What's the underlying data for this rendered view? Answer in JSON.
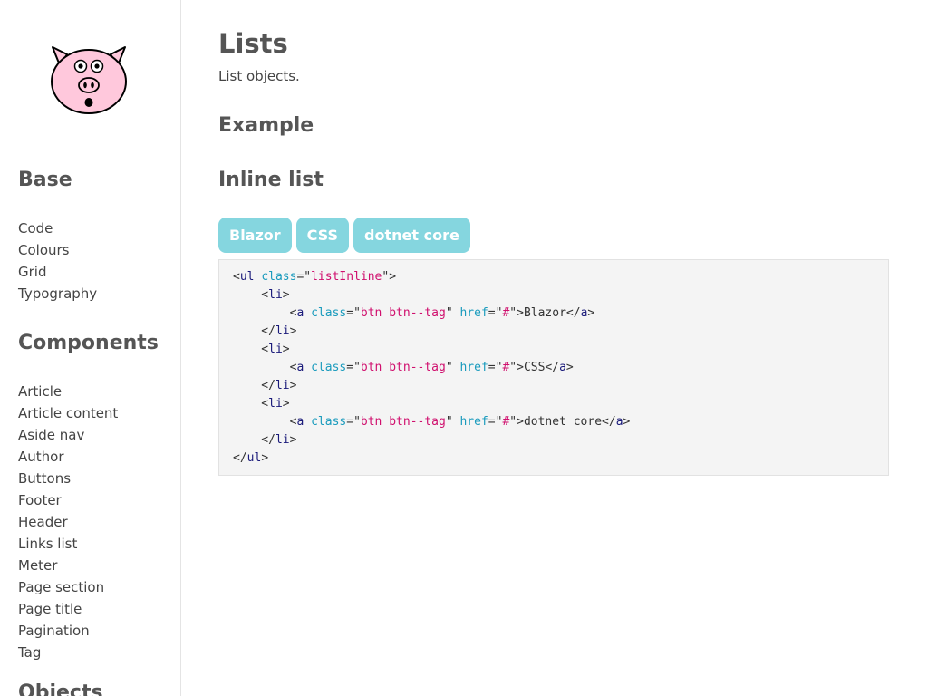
{
  "sidebar": {
    "logo": "pig-logo",
    "base_heading": "Base",
    "base_items": [
      "Code",
      "Colours",
      "Grid",
      "Typography"
    ],
    "components_heading": "Components",
    "components_items": [
      "Article",
      "Article content",
      "Aside nav",
      "Author",
      "Buttons",
      "Footer",
      "Header",
      "Links list",
      "Meter",
      "Page section",
      "Page title",
      "Pagination",
      "Tag"
    ],
    "objects_heading": "Objects"
  },
  "main": {
    "title": "Lists",
    "description": "List objects.",
    "example_heading": "Example",
    "inline_heading": "Inline list",
    "tags": [
      "Blazor",
      "CSS",
      "dotnet core"
    ]
  },
  "code": {
    "lines": [
      [
        [
          "p",
          "<"
        ],
        [
          "tg",
          "ul"
        ],
        [
          "p",
          " "
        ],
        [
          "at",
          "class"
        ],
        [
          "p",
          "=\""
        ],
        [
          "st",
          "listInline"
        ],
        [
          "p",
          "\">"
        ]
      ],
      [
        [
          "p",
          "    <"
        ],
        [
          "tg",
          "li"
        ],
        [
          "p",
          ">"
        ]
      ],
      [
        [
          "p",
          "        <"
        ],
        [
          "tg",
          "a"
        ],
        [
          "p",
          " "
        ],
        [
          "at",
          "class"
        ],
        [
          "p",
          "=\""
        ],
        [
          "st",
          "btn btn--tag"
        ],
        [
          "p",
          "\" "
        ],
        [
          "at",
          "href"
        ],
        [
          "p",
          "=\""
        ],
        [
          "st",
          "#"
        ],
        [
          "p",
          "\">"
        ],
        [
          "tx",
          "Blazor"
        ],
        [
          "p",
          "</"
        ],
        [
          "tg",
          "a"
        ],
        [
          "p",
          ">"
        ]
      ],
      [
        [
          "p",
          "    </"
        ],
        [
          "tg",
          "li"
        ],
        [
          "p",
          ">"
        ]
      ],
      [
        [
          "p",
          "    <"
        ],
        [
          "tg",
          "li"
        ],
        [
          "p",
          ">"
        ]
      ],
      [
        [
          "p",
          "        <"
        ],
        [
          "tg",
          "a"
        ],
        [
          "p",
          " "
        ],
        [
          "at",
          "class"
        ],
        [
          "p",
          "=\""
        ],
        [
          "st",
          "btn btn--tag"
        ],
        [
          "p",
          "\" "
        ],
        [
          "at",
          "href"
        ],
        [
          "p",
          "=\""
        ],
        [
          "st",
          "#"
        ],
        [
          "p",
          "\">"
        ],
        [
          "tx",
          "CSS"
        ],
        [
          "p",
          "</"
        ],
        [
          "tg",
          "a"
        ],
        [
          "p",
          ">"
        ]
      ],
      [
        [
          "p",
          "    </"
        ],
        [
          "tg",
          "li"
        ],
        [
          "p",
          ">"
        ]
      ],
      [
        [
          "p",
          "    <"
        ],
        [
          "tg",
          "li"
        ],
        [
          "p",
          ">"
        ]
      ],
      [
        [
          "p",
          "        <"
        ],
        [
          "tg",
          "a"
        ],
        [
          "p",
          " "
        ],
        [
          "at",
          "class"
        ],
        [
          "p",
          "=\""
        ],
        [
          "st",
          "btn btn--tag"
        ],
        [
          "p",
          "\" "
        ],
        [
          "at",
          "href"
        ],
        [
          "p",
          "=\""
        ],
        [
          "st",
          "#"
        ],
        [
          "p",
          "\">"
        ],
        [
          "tx",
          "dotnet core"
        ],
        [
          "p",
          "</"
        ],
        [
          "tg",
          "a"
        ],
        [
          "p",
          ">"
        ]
      ],
      [
        [
          "p",
          "    </"
        ],
        [
          "tg",
          "li"
        ],
        [
          "p",
          ">"
        ]
      ],
      [
        [
          "p",
          "</"
        ],
        [
          "tg",
          "ul"
        ],
        [
          "p",
          ">"
        ]
      ]
    ]
  },
  "colors": {
    "tag_bg": "#85d6df",
    "code_bg": "#f4f4f4",
    "code_tag": "#1a1a7a",
    "code_attr": "#1a9bbd",
    "code_string": "#d0106e",
    "logo_pink": "#ffc8dc"
  }
}
